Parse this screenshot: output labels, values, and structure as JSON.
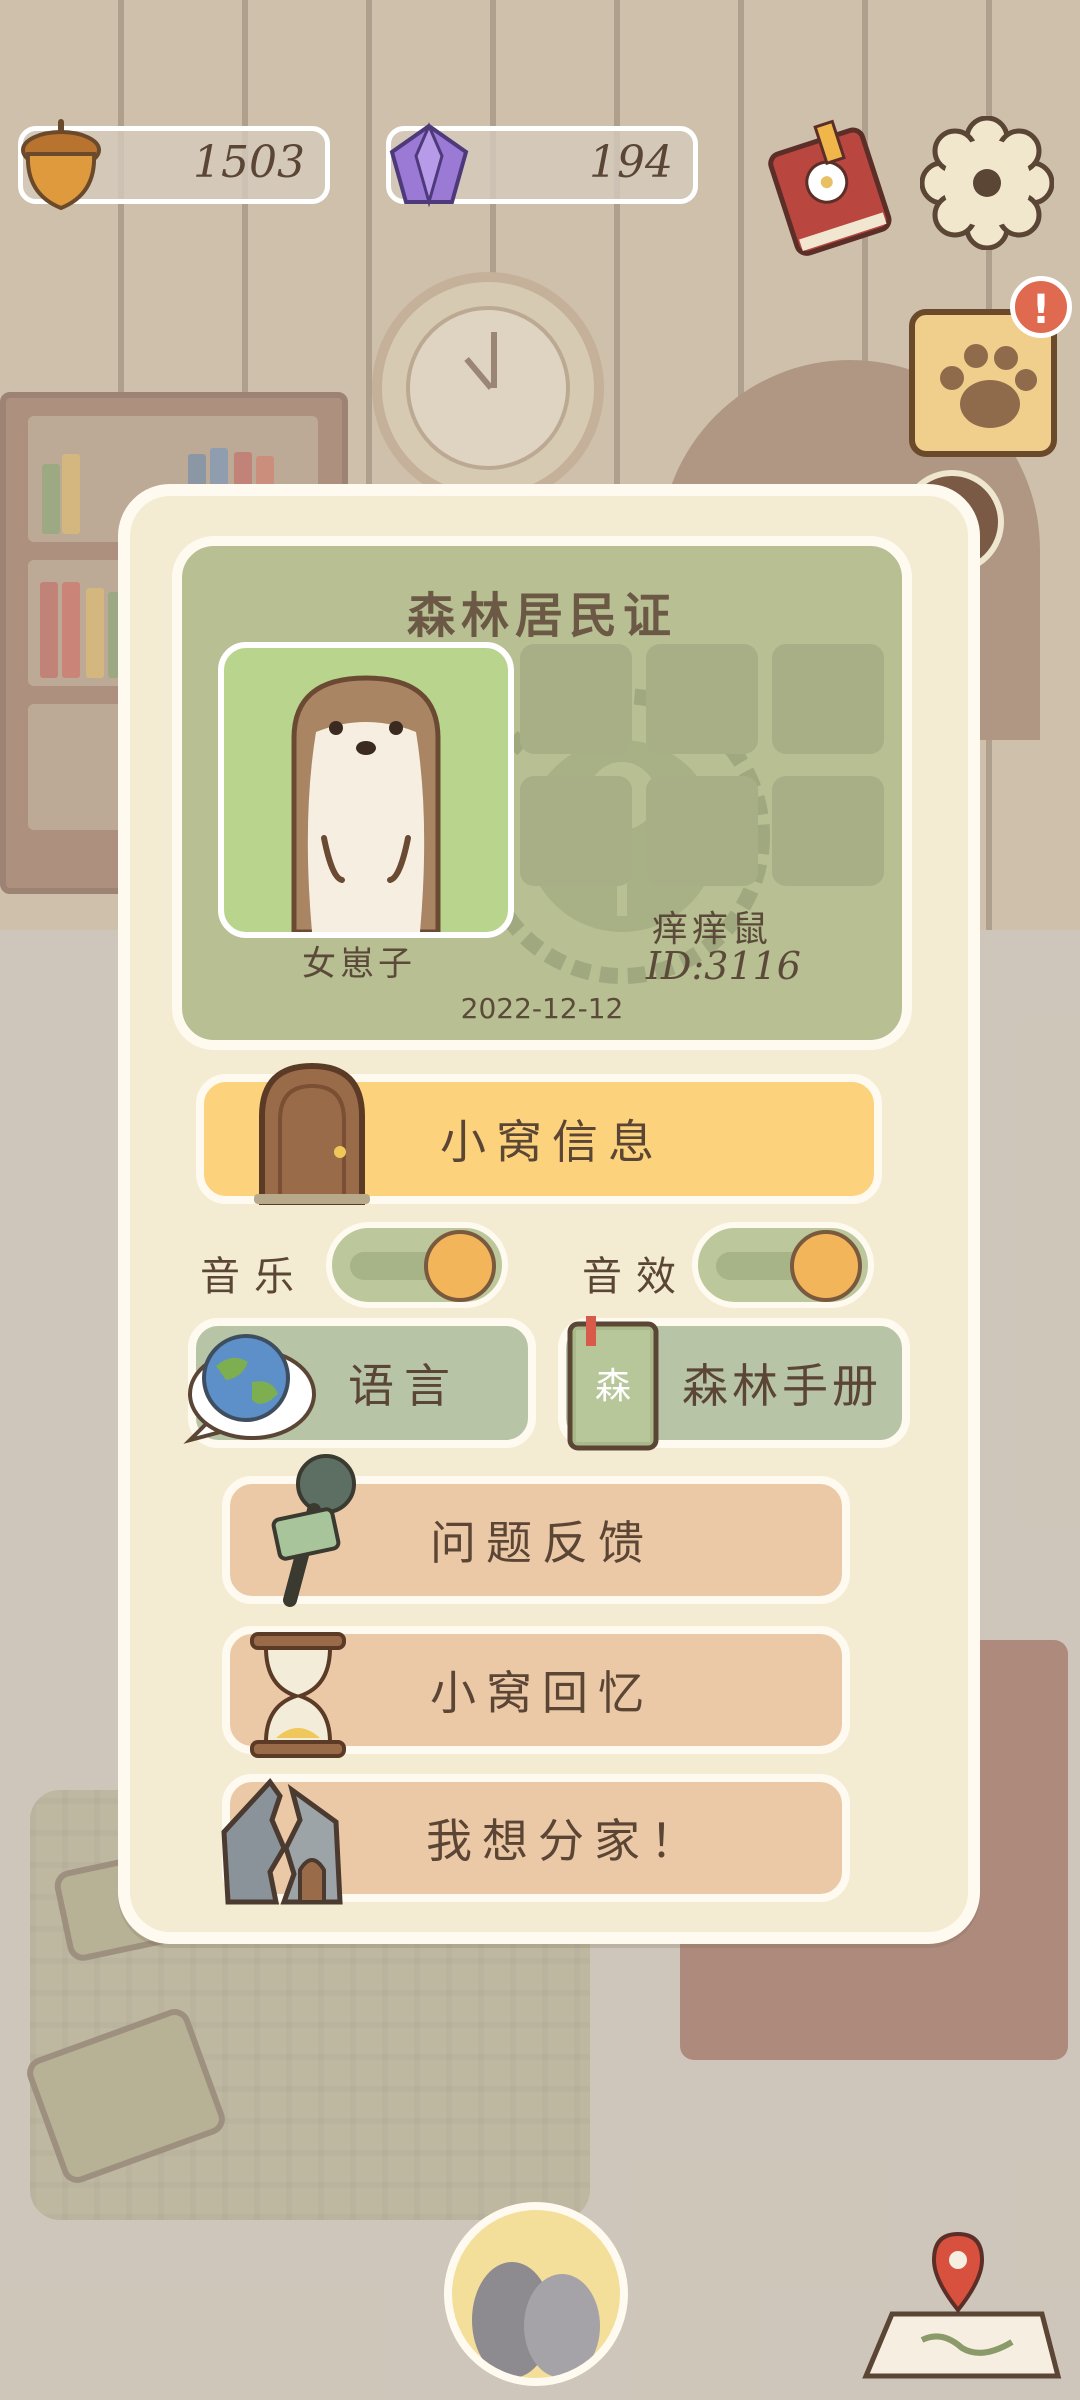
{
  "hud": {
    "acorns": "1503",
    "gems": "194"
  },
  "resident_card": {
    "title": "森林居民证",
    "owner_name": "女崽子",
    "user_name": "痒痒鼠",
    "user_id": "ID:3116",
    "date": "2022-12-12"
  },
  "menu": {
    "den_info": "小窝信息",
    "music_label": "音乐",
    "sound_label": "音效",
    "language": "语言",
    "forest_handbook": "森林手册",
    "feedback": "问题反馈",
    "den_memories": "小窝回忆",
    "move_out": "我想分家！"
  },
  "toggles": {
    "music": true,
    "sound": true
  },
  "badges": {
    "alert": "!"
  },
  "colors": {
    "panel": "#f3ecd3",
    "card": "#b7bf93",
    "den_info_button": "#fcd27c",
    "green_button": "#b8c4a6",
    "peach_button": "#ecc9a6",
    "text": "#5b4636"
  }
}
